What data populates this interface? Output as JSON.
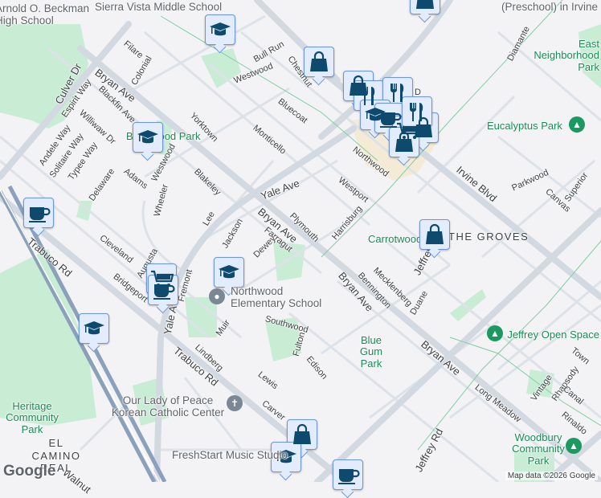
{
  "map": {
    "streets": [
      "Bryan Ave",
      "Bryan Ave",
      "Bryan Ave",
      "Bryan Ave",
      "Trabuco Rd",
      "Trabuco Rd",
      "Irvine Blvd",
      "Jeffrey Rd",
      "Jeffrey Rd",
      "Culver Dr",
      "Yale Ave",
      "Yale Ave",
      "Filare",
      "Colonial",
      "Bull Run",
      "Chestnut",
      "Westwood",
      "Westwood",
      "Bluecoat",
      "Monticello",
      "Yorktown",
      "Blackfin Ave",
      "Espirit Way",
      "Williwaw Dr",
      "Andele Way",
      "Solitaire Way",
      "Typee Way",
      "Delaware",
      "Adams",
      "Wheeler",
      "Blakeley",
      "Lee",
      "Jackson",
      "Farragut",
      "Plymouth",
      "Dewey",
      "Westport",
      "Harrisburg",
      "Northwood",
      "Cleveland",
      "Augusta",
      "Bridgeport",
      "Fremont",
      "Muir",
      "Lindberg",
      "Southwood",
      "Fulton",
      "Edison",
      "Lewis",
      "Carver",
      "Bennington",
      "Mecklenberg",
      "Duane",
      "Diamante",
      "Parkwood",
      "Canvas",
      "Superior",
      "Long Meadow",
      "Vintage",
      "Rhapsody",
      "Canal",
      "Rinaldo",
      "Town",
      "Walnut",
      "D"
    ],
    "parks": [
      "Brentwood Park",
      "Eucalyptus Park",
      "Carrotwood Park",
      "Blue Gum Park",
      "Heritage Community Park",
      "Jeffrey Open Space",
      "Woodbury Community Park",
      "East Neighborhood Park"
    ],
    "pois": [
      "Arnold O. Beckman High School",
      "Sierra Vista Middle School",
      "Northwood Elementary School",
      "Our Lady of Peace Korean Catholic Center",
      "FreshStart Music Studio",
      "(Preschool) in Irvine"
    ],
    "areas": [
      "THE GROVES",
      "EL CAMINO REAL"
    ],
    "markers": [
      "graduation-cap",
      "shopping-bag",
      "shopping-bag",
      "shopping-bag",
      "fork-knife",
      "fork-knife",
      "graduation-cap",
      "coffee-cup",
      "shopping-cart",
      "shopping-bag",
      "fork-knife",
      "shopping-bag",
      "graduation-cap",
      "coffee-cup",
      "shopping-cart",
      "coffee-cup",
      "graduation-cap",
      "graduation-cap",
      "shopping-bag",
      "shopping-bag",
      "graduation-cap",
      "coffee-cup"
    ],
    "attribution": "Map data ©2026 Google",
    "logo": "Google",
    "colors": {
      "marker_bg": "#e3ecfc",
      "marker_border": "#6b95e0",
      "icon": "#0d4a6e",
      "park": "#c8ecd4",
      "road": "#d5dbe3",
      "freeway": "#8aa0bb"
    }
  }
}
